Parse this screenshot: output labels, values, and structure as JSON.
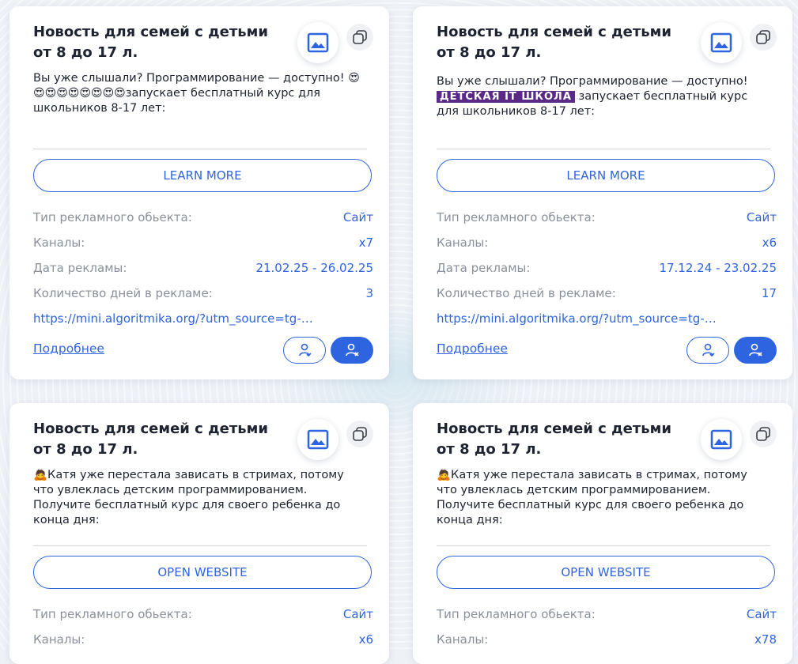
{
  "cards": [
    {
      "title": "Новость для семей с детьми от 8 до 17 л.",
      "text_a": "Вы уже слышали? Программирование — доступно! ",
      "emojis": "😍😍😍😍😍😍😍😍😍",
      "brand": "",
      "text_b": "запускает бесплатный курс для школьников 8-17 лет:",
      "cta": "LEARN MORE",
      "type_label": "Тип рекламного обьекта:",
      "type_value": "Сайт",
      "channels_label": "Каналы:",
      "channels_value": "x7",
      "date_label": "Дата рекламы:",
      "date_value": "21.02.25 - 26.02.25",
      "days_label": "Количество дней в рекламе:",
      "days_value": "3",
      "url": "https://mini.algoritmika.org/?utm_source=tg-…",
      "more": "Подробнее"
    },
    {
      "title": "Новость для семей с детьми от 8 до 17 л.",
      "text_a": "Вы уже слышали? Программирование — доступно! ",
      "emojis": "",
      "brand": "ДЕТСКАЯ IT ШКОЛА",
      "text_b": " запускает бесплатный курс для школьников 8-17 лет:",
      "cta": "LEARN MORE",
      "type_label": "Тип рекламного обьекта:",
      "type_value": "Сайт",
      "channels_label": "Каналы:",
      "channels_value": "x6",
      "date_label": "Дата рекламы:",
      "date_value": "17.12.24 - 23.02.25",
      "days_label": "Количество дней в рекламе:",
      "days_value": "17",
      "url": "https://mini.algoritmika.org/?utm_source=tg-…",
      "more": "Подробнее"
    },
    {
      "title": "Новость для семей с детьми от 8 до 17 л.",
      "text_a": "🙇Катя уже перестала зависать в стримах, потому что увлеклась детским программированием. Получите бесплатный курс для своего ребенка до конца дня:",
      "emojis": "",
      "brand": "",
      "text_b": "",
      "cta": "OPEN WEBSITE",
      "type_label": "Тип рекламного обьекта:",
      "type_value": "Сайт",
      "channels_label": "Каналы:",
      "channels_value": "x6"
    },
    {
      "title": "Новость для семей с детьми от 8 до 17 л.",
      "text_a": "🙇Катя уже перестала зависать в стримах, потому что увлеклась детским программированием. Получите бесплатный курс для своего ребенка до конца дня:",
      "emojis": "",
      "brand": "",
      "text_b": "",
      "cta": "OPEN WEBSITE",
      "type_label": "Тип рекламного обьекта:",
      "type_value": "Сайт",
      "channels_label": "Каналы:",
      "channels_value": "x78"
    }
  ],
  "icons": {
    "image": "image-icon",
    "copy": "copy-icon",
    "user_refresh": "user-refresh-icon",
    "user_remove": "user-remove-icon"
  },
  "colors": {
    "accent": "#2f64e0",
    "brand": "#5b2a86"
  }
}
